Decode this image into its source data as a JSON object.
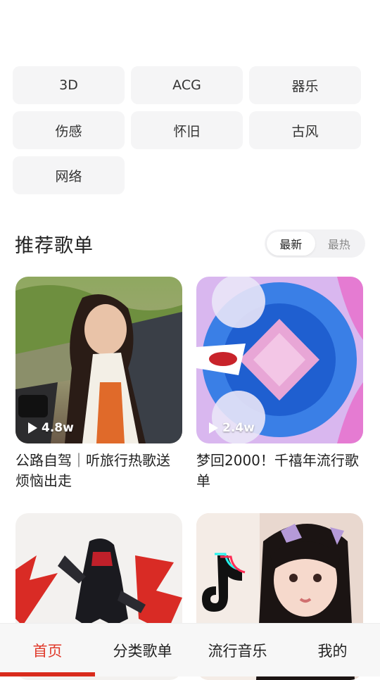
{
  "tags": [
    "3D",
    "ACG",
    "器乐",
    "伤感",
    "怀旧",
    "古风",
    "网络"
  ],
  "section": {
    "title": "推荐歌单",
    "sort_options": [
      "最新",
      "最热"
    ],
    "sort_selected": "最新"
  },
  "playlists": [
    {
      "title": "公路自驾｜听旅行热歌送烦恼出走",
      "play_count": "4.8w"
    },
    {
      "title": "梦回2000！千禧年流行歌单",
      "play_count": "2.4w"
    },
    {
      "title": "",
      "play_count": ""
    },
    {
      "title": "",
      "play_count": ""
    }
  ],
  "tabbar": {
    "items": [
      "首页",
      "分类歌单",
      "流行音乐",
      "我的"
    ],
    "active": "首页",
    "accent": "#e03a2b"
  }
}
